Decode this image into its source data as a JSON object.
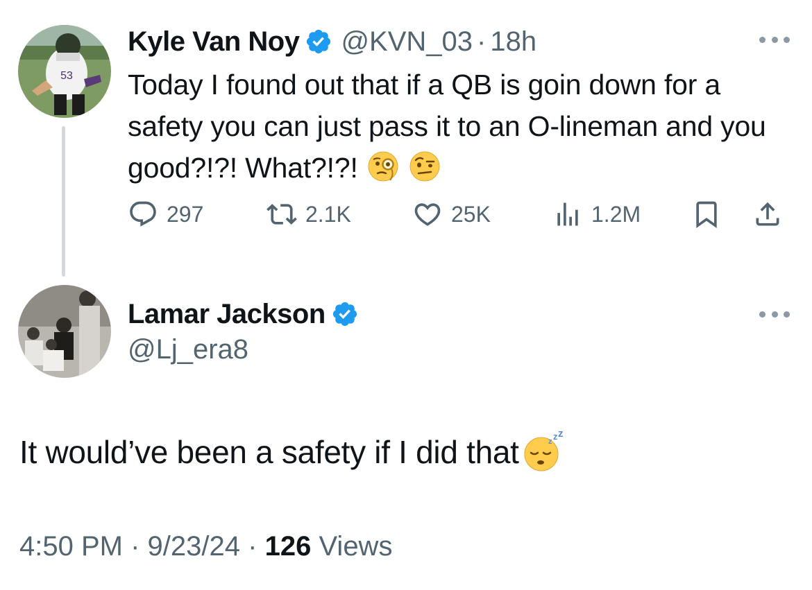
{
  "parent_tweet": {
    "author_name": "Kyle Van Noy",
    "handle": "@KVN_03",
    "separator": "·",
    "time_ago": "18h",
    "text": "Today I found out that if a QB is goin down for a safety you can just pass it to an O-lineman and you good?!?! What?!?!",
    "emojis": [
      "face-with-monocle-emoji",
      "face-with-raised-eyebrow-emoji"
    ],
    "stats": {
      "replies": "297",
      "reposts": "2.1K",
      "likes": "25K",
      "views": "1.2M"
    }
  },
  "reply_tweet": {
    "author_name": "Lamar Jackson",
    "handle": "@Lj_era8",
    "text": "It would’ve been a safety if I did that",
    "emoji": "sleeping-face-emoji",
    "time": "4:50 PM",
    "separator": "·",
    "date": "9/23/24",
    "views_count": "126",
    "views_label": "Views"
  },
  "colors": {
    "text_primary": "#0f1419",
    "text_secondary": "#536471",
    "verified_blue": "#1d9bf0",
    "thread_line": "#cfd9de"
  }
}
